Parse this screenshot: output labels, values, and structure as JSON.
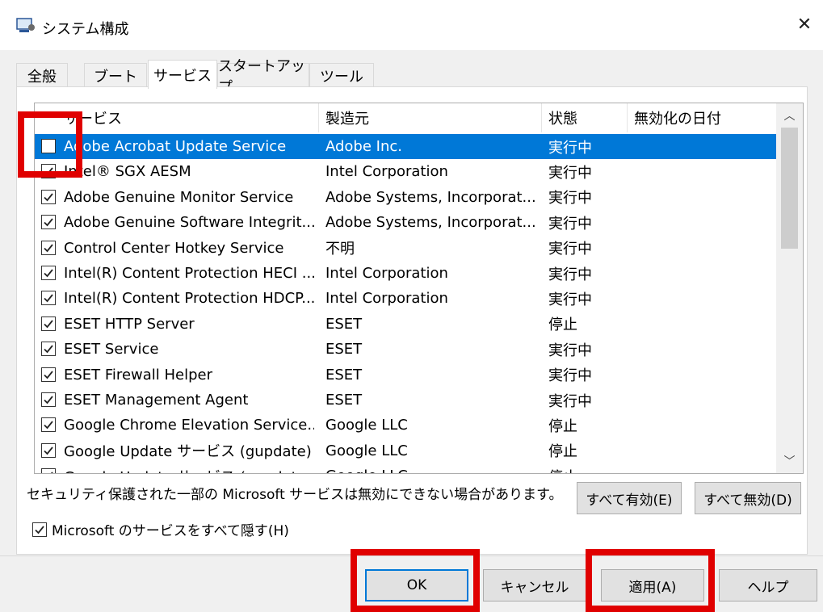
{
  "window": {
    "title": "システム構成"
  },
  "tabs": [
    {
      "label": "全般"
    },
    {
      "label": "ブート"
    },
    {
      "label": "サービス"
    },
    {
      "label": "スタートアップ"
    },
    {
      "label": "ツール"
    }
  ],
  "columns": [
    "サービス",
    "製造元",
    "状態",
    "無効化の日付"
  ],
  "services": [
    {
      "name": "Adobe Acrobat Update Service",
      "maker": "Adobe Inc.",
      "status": "実行中",
      "checked": false,
      "selected": true
    },
    {
      "name": "Intel® SGX AESM",
      "maker": "Intel Corporation",
      "status": "実行中",
      "checked": true
    },
    {
      "name": "Adobe Genuine Monitor Service",
      "maker": "Adobe Systems, Incorporat...",
      "status": "実行中",
      "checked": true
    },
    {
      "name": "Adobe Genuine Software Integrit...",
      "maker": "Adobe Systems, Incorporat...",
      "status": "実行中",
      "checked": true
    },
    {
      "name": "Control Center Hotkey Service",
      "maker": "不明",
      "status": "実行中",
      "checked": true
    },
    {
      "name": "Intel(R) Content Protection HECI ...",
      "maker": "Intel Corporation",
      "status": "実行中",
      "checked": true
    },
    {
      "name": "Intel(R) Content Protection HDCP...",
      "maker": "Intel Corporation",
      "status": "実行中",
      "checked": true
    },
    {
      "name": "ESET HTTP Server",
      "maker": "ESET",
      "status": "停止",
      "checked": true
    },
    {
      "name": "ESET Service",
      "maker": "ESET",
      "status": "実行中",
      "checked": true
    },
    {
      "name": "ESET Firewall Helper",
      "maker": "ESET",
      "status": "実行中",
      "checked": true
    },
    {
      "name": "ESET Management Agent",
      "maker": "ESET",
      "status": "実行中",
      "checked": true
    },
    {
      "name": "Google Chrome Elevation Service...",
      "maker": "Google LLC",
      "status": "停止",
      "checked": true
    },
    {
      "name": "Google Update サービス (gupdate)",
      "maker": "Google LLC",
      "status": "停止",
      "checked": true
    },
    {
      "name": "Google Update サービス (gupdatem)",
      "maker": "Google LLC",
      "status": "停止",
      "checked": true
    }
  ],
  "note": "セキュリティ保護された一部の Microsoft サービスは無効にできない場合があります。",
  "buttons": {
    "enable_all": "すべて有効(E)",
    "disable_all": "すべて無効(D)",
    "ok": "OK",
    "cancel": "キャンセル",
    "apply": "適用(A)",
    "help": "ヘルプ"
  },
  "hide_ms": {
    "label": "Microsoft のサービスをすべて隠す(H)",
    "checked": true
  },
  "icons": {
    "app": "system-config-icon",
    "close": "close-icon",
    "check": "checkmark-icon"
  },
  "colors": {
    "selection": "#0078d7",
    "highlight": "#e00000"
  }
}
